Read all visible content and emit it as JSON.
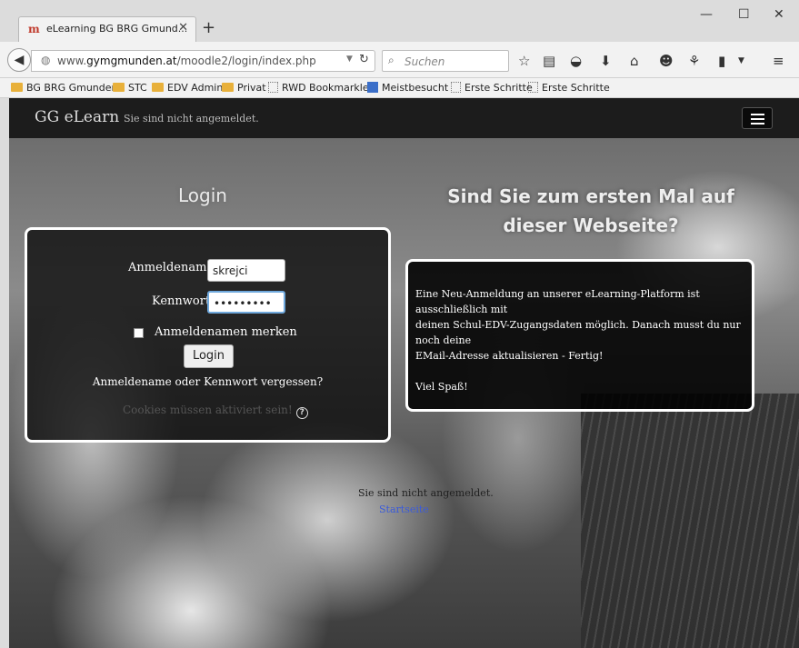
{
  "browser": {
    "tab_title": "eLearning BG BRG Gmund...",
    "url_prefix": "www.",
    "url_domain": "gymgmunden.at",
    "url_path": "/moodle2/login/index.php",
    "search_placeholder": "Suchen",
    "bookmarks": [
      {
        "label": "BG BRG Gmunden",
        "icon": "folder-icon"
      },
      {
        "label": "STC",
        "icon": "folder-icon"
      },
      {
        "label": "EDV Admin",
        "icon": "folder-icon"
      },
      {
        "label": "Privat",
        "icon": "folder-icon"
      },
      {
        "label": "RWD Bookmarklet",
        "icon": "page-icon"
      },
      {
        "label": "Meistbesucht",
        "icon": "star-icon"
      },
      {
        "label": "Erste Schritte",
        "icon": "page-icon"
      },
      {
        "label": "Erste Schritte",
        "icon": "page-icon"
      }
    ]
  },
  "site": {
    "brand": "GG eLearn",
    "status": "Sie sind nicht angemeldet."
  },
  "login": {
    "heading": "Login",
    "username_label": "Anmeldename",
    "username_value": "skrejci",
    "password_label": "Kennwort",
    "password_value": "•••••••••",
    "remember_label": "Anmeldenamen merken",
    "remember_checked": false,
    "button_label": "Login",
    "forgot_link": "Anmeldename oder Kennwort vergessen?",
    "cookies_note": "Cookies müssen aktiviert sein!"
  },
  "signup": {
    "heading": "Sind Sie zum ersten Mal auf dieser Webseite?",
    "lines": [
      "Eine Neu-Anmeldung an unserer eLearning-Platform ist ausschließlich mit",
      "deinen Schul-EDV-Zugangsdaten möglich. Danach musst du nur noch deine",
      "EMail-Adresse aktualisieren - Fertig!"
    ],
    "closing": "Viel Spaß!"
  },
  "footer": {
    "status": "Sie sind nicht angemeldet.",
    "home_link": "Startseite"
  },
  "colors": {
    "header_bg": "#1c1c1c",
    "link": "#3b5bd9",
    "folder": "#e8b03a"
  }
}
